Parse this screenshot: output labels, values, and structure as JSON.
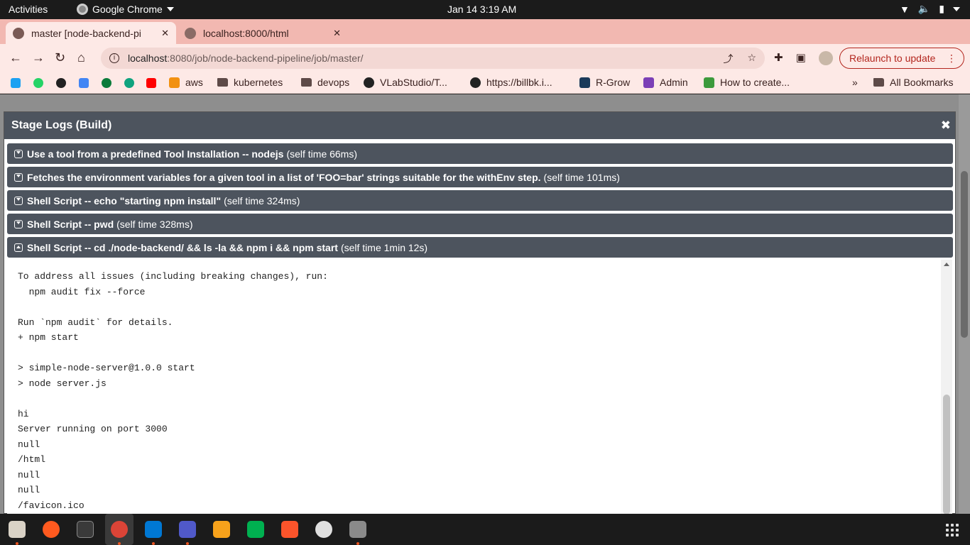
{
  "topbar": {
    "activities": "Activities",
    "app_name": "Google Chrome",
    "clock": "Jan 14  3:19 AM"
  },
  "tabs": [
    {
      "title": "master [node-backend-pi",
      "active": true
    },
    {
      "title": "localhost:8000/html",
      "active": false
    }
  ],
  "toolbar": {
    "url_host": "localhost",
    "url_path": ":8080/job/node-backend-pipeline/job/master/",
    "relaunch_label": "Relaunch to update"
  },
  "bookmarks": {
    "items": [
      "aws",
      "kubernetes",
      "devops",
      "VLabStudio/T...",
      "https://billbk.i...",
      "R-Grow",
      "Admin",
      "How to create..."
    ],
    "overflow": "»",
    "all_bookmarks": "All Bookmarks"
  },
  "modal": {
    "title": "Stage Logs (Build)",
    "close": "✖",
    "steps": [
      {
        "name": "Use a tool from a predefined Tool Installation -- nodejs",
        "time": "(self time 66ms)",
        "expanded": false
      },
      {
        "name": "Fetches the environment variables for a given tool in a list of 'FOO=bar' strings suitable for the withEnv step.",
        "time": "(self time 101ms)",
        "expanded": false
      },
      {
        "name": "Shell Script -- echo \"starting npm install\"",
        "time": "(self time 324ms)",
        "expanded": false
      },
      {
        "name": "Shell Script -- pwd",
        "time": "(self time 328ms)",
        "expanded": false
      },
      {
        "name": "Shell Script -- cd ./node-backend/ && ls -la && npm i && npm start",
        "time": "(self time 1min 12s)",
        "expanded": true
      }
    ],
    "log": "To address all issues (including breaking changes), run:\n  npm audit fix --force\n\nRun `npm audit` for details.\n+ npm start\n\n> simple-node-server@1.0.0 start\n> node server.js\n\nhi\nServer running on port 3000\nnull\n/html\nnull\nnull\n/favicon.ico"
  },
  "colors": {
    "tab_strip": "#f2b8b1",
    "toolbar": "#fde9e6",
    "modal_header": "#4d545e",
    "relaunch": "#b3261e"
  }
}
